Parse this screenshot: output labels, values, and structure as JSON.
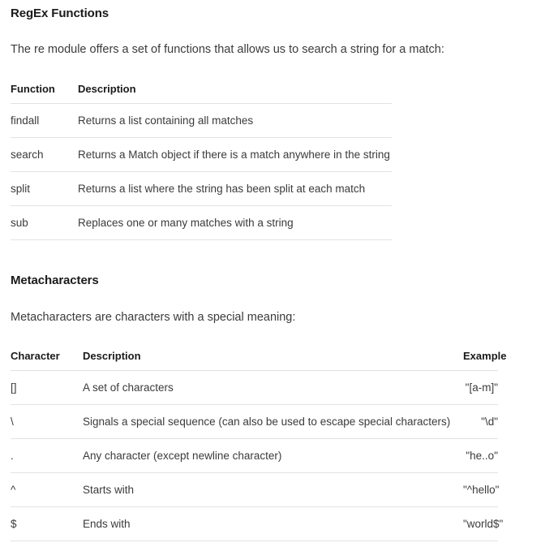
{
  "sections": [
    {
      "heading": "RegEx Functions",
      "paragraph": "The re module offers a set of functions that allows us to search a string for a match:"
    },
    {
      "heading": "Metacharacters",
      "paragraph": "Metacharacters are characters with a special meaning:"
    }
  ],
  "functions_table": {
    "headers": {
      "function": "Function",
      "description": "Description"
    },
    "rows": [
      {
        "function": "findall",
        "description": "Returns a list containing all matches"
      },
      {
        "function": "search",
        "description": "Returns a Match object if there is a match anywhere in the string"
      },
      {
        "function": "split",
        "description": "Returns a list where the string has been split at each match"
      },
      {
        "function": "sub",
        "description": "Replaces one or many matches with a string"
      }
    ]
  },
  "metacharacters_table": {
    "headers": {
      "character": "Character",
      "description": "Description",
      "example": "Example"
    },
    "rows": [
      {
        "character": "[]",
        "description": "A set of characters",
        "example": "\"[a-m]\""
      },
      {
        "character": "\\",
        "description": "Signals a special sequence (can also be used to escape special characters)",
        "example": "\"\\d\""
      },
      {
        "character": ".",
        "description": "Any character (except newline character)",
        "example": "\"he..o\""
      },
      {
        "character": "^",
        "description": "Starts with",
        "example": "\"^hello\""
      },
      {
        "character": "$",
        "description": "Ends with",
        "example": "\"world$\""
      }
    ]
  },
  "colors": {
    "heading": "#1a1a1a",
    "body_text": "#3b3b3b",
    "table_rule": "#e2e2e2",
    "background": "#ffffff"
  }
}
